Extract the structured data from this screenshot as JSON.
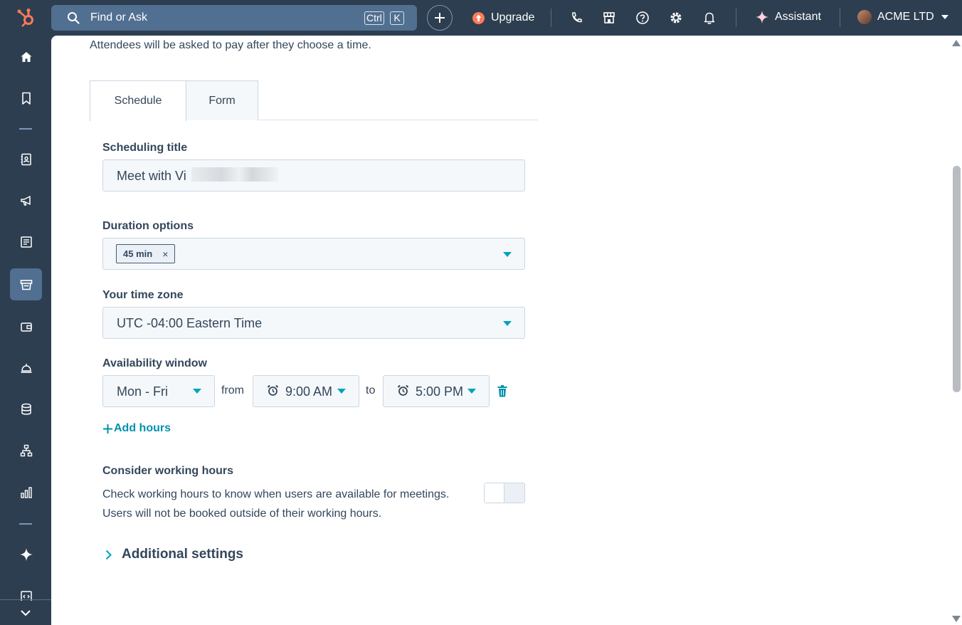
{
  "colors": {
    "nav_bg": "#2d3e50",
    "accent_teal": "#00a4bd",
    "link_teal": "#0091ae",
    "upgrade_orange": "#ff7a59",
    "logo_orange": "#ff7a59"
  },
  "topbar": {
    "search_placeholder": "Find or Ask",
    "kbd_ctrl": "Ctrl",
    "kbd_k": "K",
    "upgrade_label": "Upgrade",
    "assistant_label": "Assistant",
    "account_name": "ACME LTD",
    "icons": [
      "hubspot-logo-icon",
      "search-icon",
      "plus-icon",
      "upgrade-arrow-icon",
      "phone-icon",
      "marketplace-icon",
      "help-icon",
      "settings-icon",
      "notifications-icon",
      "sparkle-icon",
      "chevron-down-icon"
    ]
  },
  "sidebar": {
    "items": [
      "home",
      "bookmarks",
      "contacts",
      "marketing",
      "content",
      "commerce",
      "sales",
      "service",
      "data-management",
      "automation",
      "reporting",
      "breeze",
      "development"
    ],
    "active": "commerce"
  },
  "main": {
    "intro_text": "Attendees will be asked to pay after they choose a time.",
    "tabs": [
      {
        "label": "Schedule",
        "active": true
      },
      {
        "label": "Form",
        "active": false
      }
    ],
    "scheduling_title": {
      "label": "Scheduling title",
      "value": "Meet with Vi"
    },
    "duration": {
      "label": "Duration options",
      "tag": "45 min",
      "remove": "×"
    },
    "timezone": {
      "label": "Your time zone",
      "value": "UTC -04:00 Eastern Time"
    },
    "availability": {
      "label": "Availability window",
      "days": "Mon - Fri",
      "from_label": "from",
      "start": "9:00 AM",
      "to_label": "to",
      "end": "5:00 PM"
    },
    "add_hours": "Add hours",
    "working_hours": {
      "label": "Consider working hours",
      "line1": "Check working hours to know when users are available for meetings.",
      "line2": "Users will not be booked outside of their working hours.",
      "enabled": false
    },
    "additional_settings": "Additional settings"
  }
}
